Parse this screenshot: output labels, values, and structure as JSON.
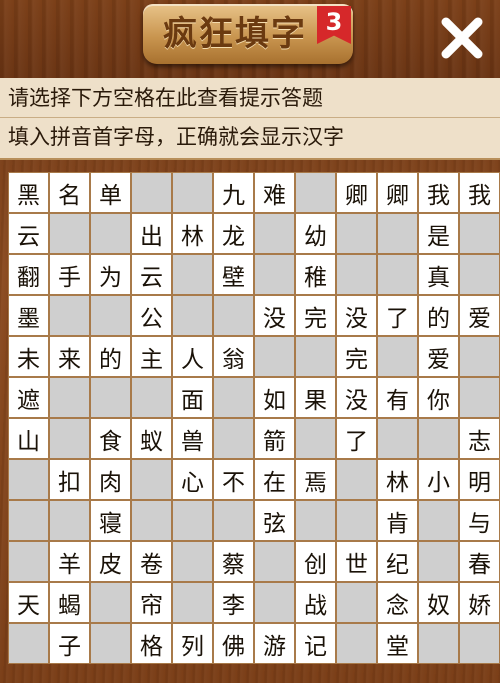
{
  "header": {
    "title": "疯狂填字",
    "level": "3",
    "close_icon": "close-icon"
  },
  "hints": {
    "line1": "请选择下方空格在此查看提示答题",
    "line2": "填入拼音首字母，正确就会显示汉字"
  },
  "colors": {
    "white_cell": "#ffffff",
    "gray_cell": "#cfcfcf",
    "wood": "#7b3f18",
    "badge": "#d6282a"
  },
  "grid": {
    "rows": [
      [
        "黑",
        "名",
        "单",
        "#",
        "#",
        "九",
        "难",
        "#",
        "卿",
        "卿",
        "我",
        "我"
      ],
      [
        "云",
        "#",
        "#",
        "出",
        "林",
        "龙",
        "#",
        "幼",
        "#",
        "#",
        "是",
        "#"
      ],
      [
        "翻",
        "手",
        "为",
        "云",
        "#",
        "壁",
        "#",
        "稚",
        "#",
        "#",
        "真",
        "#"
      ],
      [
        "墨",
        "#",
        "#",
        "公",
        "#",
        "#",
        "没",
        "完",
        "没",
        "了",
        "的",
        "爱"
      ],
      [
        "未",
        "来",
        "的",
        "主",
        "人",
        "翁",
        "#",
        "#",
        "完",
        "#",
        "爱",
        "#"
      ],
      [
        "遮",
        "#",
        "#",
        "#",
        "面",
        "#",
        "如",
        "果",
        "没",
        "有",
        "你",
        "#"
      ],
      [
        "山",
        "#",
        "食",
        "蚁",
        "兽",
        "#",
        "箭",
        "#",
        "了",
        "#",
        "#",
        "志"
      ],
      [
        "#",
        "扣",
        "肉",
        "#",
        "心",
        "不",
        "在",
        "焉",
        "#",
        "林",
        "小",
        "明"
      ],
      [
        "#",
        "#",
        "寝",
        "#",
        "#",
        "#",
        "弦",
        "#",
        "#",
        "肯",
        "#",
        "与"
      ],
      [
        "#",
        "羊",
        "皮",
        "卷",
        "#",
        "蔡",
        "#",
        "创",
        "世",
        "纪",
        "#",
        "春"
      ],
      [
        "天",
        "蝎",
        "#",
        "帘",
        "#",
        "李",
        "#",
        "战",
        "#",
        "念",
        "奴",
        "娇"
      ],
      [
        "#",
        "子",
        "#",
        "格",
        "列",
        "佛",
        "游",
        "记",
        "#",
        "堂",
        "#",
        "#"
      ]
    ],
    "white": [
      [
        1,
        1,
        1,
        0,
        0,
        1,
        1,
        0,
        1,
        1,
        1,
        1
      ],
      [
        1,
        0,
        0,
        1,
        1,
        1,
        0,
        1,
        0,
        0,
        1,
        0
      ],
      [
        1,
        1,
        1,
        1,
        0,
        1,
        0,
        1,
        0,
        0,
        1,
        0
      ],
      [
        1,
        0,
        0,
        1,
        0,
        0,
        1,
        1,
        1,
        1,
        1,
        1
      ],
      [
        1,
        1,
        1,
        1,
        1,
        1,
        0,
        0,
        1,
        0,
        1,
        0
      ],
      [
        1,
        0,
        0,
        0,
        1,
        0,
        1,
        1,
        1,
        1,
        1,
        0
      ],
      [
        1,
        0,
        1,
        1,
        1,
        0,
        1,
        0,
        1,
        0,
        0,
        1
      ],
      [
        0,
        1,
        1,
        0,
        1,
        1,
        1,
        1,
        0,
        1,
        1,
        1
      ],
      [
        0,
        0,
        1,
        0,
        0,
        0,
        1,
        0,
        0,
        1,
        0,
        1
      ],
      [
        0,
        1,
        1,
        1,
        0,
        1,
        0,
        1,
        1,
        1,
        0,
        1
      ],
      [
        1,
        1,
        0,
        1,
        0,
        1,
        0,
        1,
        0,
        1,
        1,
        1
      ],
      [
        0,
        1,
        0,
        1,
        1,
        1,
        1,
        1,
        0,
        1,
        0,
        0
      ]
    ]
  }
}
